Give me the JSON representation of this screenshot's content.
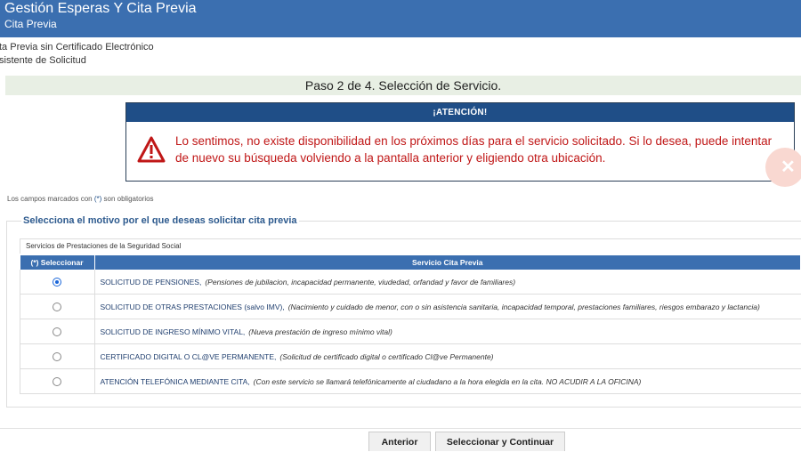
{
  "header": {
    "title": "Gestión Esperas Y Cita Previa",
    "subtitle": "Cita Previa"
  },
  "breadcrumbs": [
    "ta Previa sin Certificado Electrónico",
    "sistente de Solicitud"
  ],
  "step": "Paso 2 de 4. Selección de Servicio.",
  "alert": {
    "heading": "¡ATENCIÓN!",
    "message": "Lo sentimos, no existe disponibilidad en los próximos días para el servicio solicitado. Si lo desea, puede intentar de nuevo su búsqueda volviendo a la pantalla anterior y eligiendo otra ubicación.",
    "color": "#c01717"
  },
  "required_note": {
    "before": "Los campos marcados con ",
    "asterisk": "(*)",
    "after": " son obligatorios"
  },
  "form": {
    "legend": "Selecciona el motivo por el que deseas solicitar cita previa",
    "section": "Servicios de Prestaciones de la Seguridad Social",
    "columns": [
      "(*) Seleccionar",
      "Servicio Cita Previa"
    ],
    "rows": [
      {
        "name": "SOLICITUD DE PENSIONES,",
        "desc": "(Pensiones de jubilacion, incapacidad permanente, viudedad, orfandad y favor de familiares)",
        "selected": true
      },
      {
        "name": "SOLICITUD DE OTRAS PRESTACIONES (salvo IMV),",
        "desc": "(Nacimiento y cuidado de menor, con o sin asistencia sanitaria, incapacidad temporal, prestaciones familiares, riesgos embarazo y lactancia)",
        "selected": false
      },
      {
        "name": "SOLICITUD DE INGRESO MÍNIMO VITAL,",
        "desc": "(Nueva prestación de ingreso mínimo vital)",
        "selected": false
      },
      {
        "name": "CERTIFICADO DIGITAL O CL@VE PERMANENTE,",
        "desc": "(Solicitud de certificado digital o certificado Cl@ve Permanente)",
        "selected": false
      },
      {
        "name": "ATENCIÓN TELEFÓNICA MEDIANTE CITA,",
        "desc": "(Con este servicio se llamará telefónicamente al ciudadano a la hora elegida en la cita. NO ACUDIR A LA OFICINA)",
        "selected": false
      }
    ]
  },
  "buttons": {
    "previous": "Anterior",
    "next": "Seleccionar y Continuar"
  },
  "colors": {
    "header": "#3b6fb0",
    "alert_header": "#1f4e87",
    "step_bar": "#e8efe4"
  }
}
